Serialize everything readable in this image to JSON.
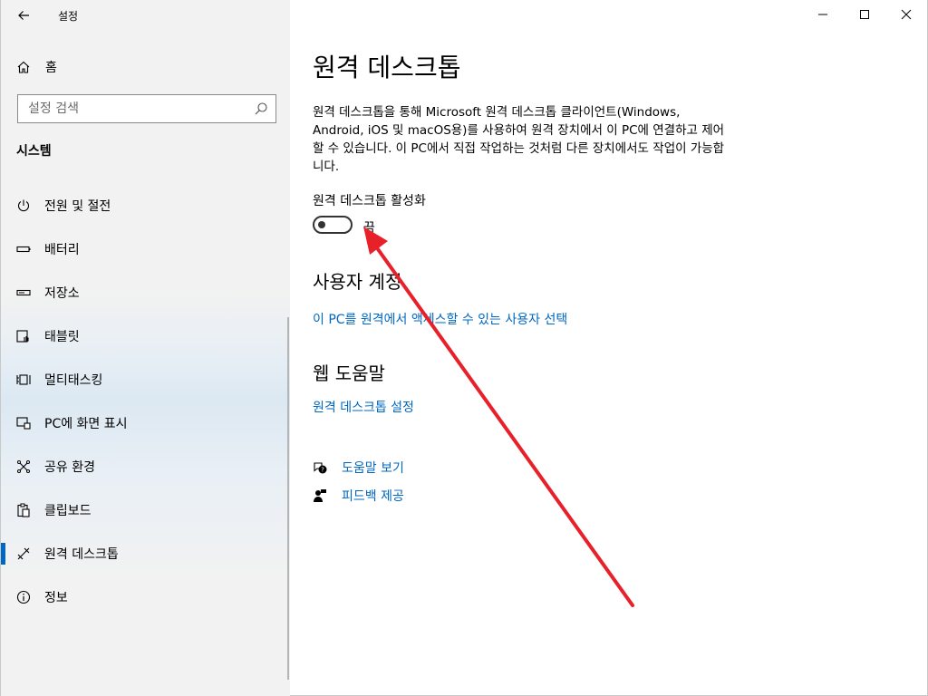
{
  "window": {
    "title": "설정"
  },
  "sidebar": {
    "home_label": "홈",
    "search_placeholder": "설정 검색",
    "section_title": "시스템",
    "items": [
      {
        "label": "전원 및 절전",
        "icon": "power-icon"
      },
      {
        "label": "배터리",
        "icon": "battery-icon"
      },
      {
        "label": "저장소",
        "icon": "storage-icon"
      },
      {
        "label": "태블릿",
        "icon": "tablet-icon"
      },
      {
        "label": "멀티태스킹",
        "icon": "multitasking-icon"
      },
      {
        "label": "PC에 화면 표시",
        "icon": "projecting-icon"
      },
      {
        "label": "공유 환경",
        "icon": "shared-experiences-icon"
      },
      {
        "label": "클립보드",
        "icon": "clipboard-icon"
      },
      {
        "label": "원격 데스크톱",
        "icon": "remote-desktop-icon",
        "active": true
      },
      {
        "label": "정보",
        "icon": "info-icon"
      }
    ]
  },
  "main": {
    "title": "원격 데스크톱",
    "description": "원격 데스크톱을 통해 Microsoft 원격 데스크톱 클라이언트(Windows, Android, iOS 및 macOS용)를 사용하여 원격 장치에서 이 PC에 연결하고 제어할 수 있습니다. 이 PC에서 직접 작업하는 것처럼 다른 장치에서도 작업이 가능합니다.",
    "toggle_label": "원격 데스크톱 활성화",
    "toggle_state": "끔",
    "toggle_on": false,
    "user_accounts": {
      "heading": "사용자 계정",
      "link": "이 PC를 원격에서 액세스할 수 있는 사용자 선택"
    },
    "web_help": {
      "heading": "웹 도움말",
      "link": "원격 데스크톱 설정"
    },
    "help_links": [
      {
        "label": "도움말 보기",
        "icon": "get-help-icon"
      },
      {
        "label": "피드백 제공",
        "icon": "feedback-icon"
      }
    ]
  },
  "colors": {
    "accent": "#0067c0",
    "annotation_arrow": "#e8202a"
  }
}
